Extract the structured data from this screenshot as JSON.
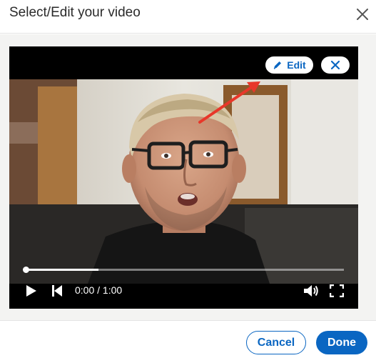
{
  "dialog": {
    "title": "Select/Edit your video",
    "close_icon": "close-icon"
  },
  "player": {
    "edit_label": "Edit",
    "edit_icon": "pencil-icon",
    "remove_icon": "close-icon",
    "time_display": "0:00 / 1:00",
    "progress": 0,
    "buffered_fraction": 0.23,
    "controls": [
      "play-icon",
      "skip-back-icon",
      "volume-icon",
      "fullscreen-icon"
    ]
  },
  "annotation": {
    "arrow_color": "#e8372a"
  },
  "footer": {
    "cancel_label": "Cancel",
    "done_label": "Done"
  },
  "colors": {
    "accent": "#0a66c2"
  }
}
